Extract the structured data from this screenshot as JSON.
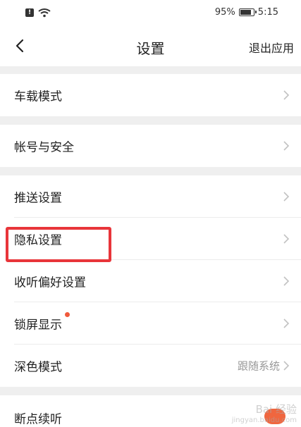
{
  "status_bar": {
    "battery_percent": "95%",
    "battery_level": 0.95,
    "time": "5:15",
    "alert_icon": "alert-icon",
    "wifi_icon": "wifi-icon"
  },
  "nav": {
    "back_icon": "back-arrow-icon",
    "title": "设置",
    "exit_label": "退出应用"
  },
  "settings": {
    "car_mode": "车载模式",
    "account_security": "帐号与安全",
    "push_settings": "推送设置",
    "privacy_settings": "隐私设置",
    "listening_preferences": "收听偏好设置",
    "lock_screen_display": "锁屏显示",
    "dark_mode": "深色模式",
    "dark_mode_value": "跟随系统",
    "resume_playback": "断点续听"
  },
  "watermark": {
    "brand": "Bai 经验",
    "url": "jingyan.baidu.com"
  },
  "colors": {
    "accent_dot": "#f05a3c",
    "highlight": "#e8353a",
    "background": "#efefef"
  }
}
